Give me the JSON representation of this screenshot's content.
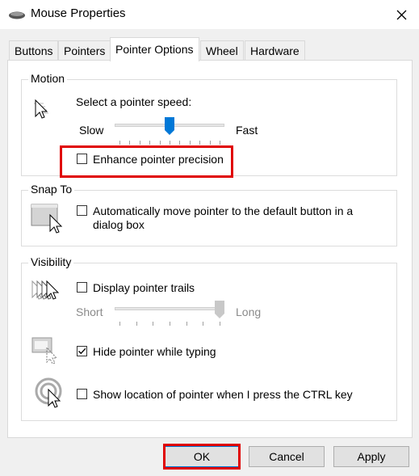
{
  "window": {
    "title": "Mouse Properties",
    "icon": "mouse-icon",
    "close_icon": "close-icon"
  },
  "tabs": [
    "Buttons",
    "Pointers",
    "Pointer Options",
    "Wheel",
    "Hardware"
  ],
  "active_tab": "Pointer Options",
  "motion": {
    "legend": "Motion",
    "speed_label": "Select a pointer speed:",
    "slow_label": "Slow",
    "fast_label": "Fast",
    "speed_level": 0.5,
    "enhance_precision_label": "Enhance pointer precision",
    "enhance_precision_checked": false
  },
  "snap_to": {
    "legend": "Snap To",
    "auto_move_label_line1": "Automatically move pointer to the default button in a",
    "auto_move_label_line2": "dialog box",
    "auto_move_checked": false
  },
  "visibility": {
    "legend": "Visibility",
    "trails_label": "Display pointer trails",
    "trails_checked": false,
    "short_label": "Short",
    "long_label": "Long",
    "trail_length_level": 1.0,
    "hide_while_typing_label": "Hide pointer while typing",
    "hide_while_typing_checked": true,
    "show_location_label": "Show location of pointer when I press the CTRL key",
    "show_location_checked": false
  },
  "buttons": {
    "ok": "OK",
    "cancel": "Cancel",
    "apply": "Apply"
  },
  "colors": {
    "accent": "#0078d7",
    "highlight": "#e00000"
  }
}
